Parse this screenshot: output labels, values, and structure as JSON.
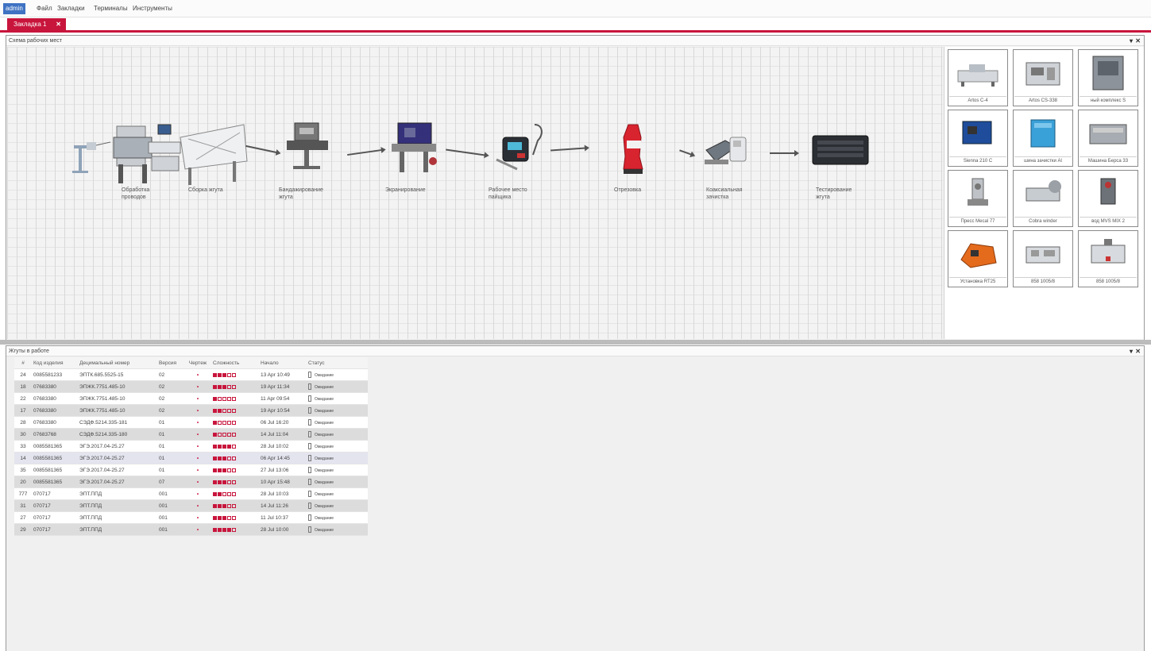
{
  "menubar": {
    "items": [
      "admin",
      "Файл",
      "Закладки",
      "Терминалы",
      "Инструменты"
    ]
  },
  "tab": {
    "label": "Закладка 1",
    "close": "✕"
  },
  "scheme_panel": {
    "title": "Схема рабочих мест",
    "pin": "▾",
    "close": "✕"
  },
  "flow": {
    "stations": [
      {
        "label": "Обработка\nпроводов"
      },
      {
        "label": "Сборка жгута"
      },
      {
        "label": "Бандажирование\nжгута"
      },
      {
        "label": "Экранирование"
      },
      {
        "label": "Рабочее место\nпайщика"
      },
      {
        "label": "Отрезовка"
      },
      {
        "label": "Коаксиальная\nзачистка"
      },
      {
        "label": "Тестирование\nжгута"
      }
    ]
  },
  "equipment": [
    {
      "label": "Artos C-4",
      "icon": "wire-cutting-machine-icon"
    },
    {
      "label": "Artos CS-338",
      "icon": "crimp-machine-icon"
    },
    {
      "label": "ный комплекс S",
      "icon": "cabinet-machine-icon"
    },
    {
      "label": "Sienna 210 C",
      "icon": "blue-machine-icon"
    },
    {
      "label": "шина зачистки Al",
      "icon": "blue-box-icon"
    },
    {
      "label": "Машина Берса 33",
      "icon": "grey-machine-icon"
    },
    {
      "label": "Пресс Mecal 77",
      "icon": "press-icon"
    },
    {
      "label": "Cobra winder",
      "icon": "winder-icon"
    },
    {
      "label": "вод MVS MIX 2",
      "icon": "mixer-icon"
    },
    {
      "label": "Установка RT25",
      "icon": "orange-unit-icon"
    },
    {
      "label": "858 1005/8",
      "icon": "bench-unit-icon"
    },
    {
      "label": "858 1005/8",
      "icon": "bench-unit-icon"
    }
  ],
  "harness_panel": {
    "title": "Жгуты в работе",
    "pin": "▾",
    "close": "✕"
  },
  "table": {
    "headers": {
      "num": "#",
      "code": "Код изделия",
      "decimal": "Децимальный номер",
      "version": "Версия",
      "drawing": "Чертеж",
      "complexity": "Сложность",
      "start": "Начало",
      "status": "Статус"
    },
    "rows": [
      {
        "num": "24",
        "code": "0085581233",
        "decimal": "ЭПТК.685.5525-15",
        "version": "02",
        "drawing": "•",
        "complexity": 3,
        "start": "13 Apr 10:49",
        "status": "Ожидание"
      },
      {
        "num": "18",
        "code": "07683380",
        "decimal": "ЭПЖК.7751.485-10",
        "version": "02",
        "drawing": "•",
        "complexity": 3,
        "start": "19 Apr 11:34",
        "status": "Ожидание"
      },
      {
        "num": "22",
        "code": "07683380",
        "decimal": "ЭПЖК.7751.485-10",
        "version": "02",
        "drawing": "•",
        "complexity": 1,
        "start": "11 Apr 09:54",
        "status": "Ожидание"
      },
      {
        "num": "17",
        "code": "07683380",
        "decimal": "ЭПЖК.7751.485-10",
        "version": "02",
        "drawing": "•",
        "complexity": 2,
        "start": "19 Apr 10:54",
        "status": "Ожидание"
      },
      {
        "num": "28",
        "code": "07683380",
        "decimal": "СЭДФ.5214.335-181",
        "version": "01",
        "drawing": "•",
        "complexity": 1,
        "start": "06 Jul 16:20",
        "status": "Ожидание"
      },
      {
        "num": "30",
        "code": "07683768",
        "decimal": "СЭДФ.5214.335-180",
        "version": "01",
        "drawing": "•",
        "complexity": 1,
        "start": "14 Jul 11:04",
        "status": "Ожидание"
      },
      {
        "num": "33",
        "code": "0085581365",
        "decimal": "ЭГЭ.2017.04-25.27",
        "version": "01",
        "drawing": "•",
        "complexity": 4,
        "start": "28 Jul 10:02",
        "status": "Ожидание"
      },
      {
        "num": "14",
        "code": "0085581365",
        "decimal": "ЭГЭ.2017.04-25.27",
        "version": "01",
        "drawing": "•",
        "complexity": 3,
        "start": "06 Apr 14:45",
        "status": "Ожидание"
      },
      {
        "num": "35",
        "code": "0085581365",
        "decimal": "ЭГЭ.2017.04-25.27",
        "version": "01",
        "drawing": "•",
        "complexity": 3,
        "start": "27 Jul 13:06",
        "status": "Ожидание"
      },
      {
        "num": "20",
        "code": "0085581365",
        "decimal": "ЭГЭ.2017.04-25.27",
        "version": "07",
        "drawing": "•",
        "complexity": 3,
        "start": "10 Apr 15:48",
        "status": "Ожидание"
      },
      {
        "num": "777",
        "code": "070717",
        "decimal": "ЭПТ.ППД",
        "version": "001",
        "drawing": "•",
        "complexity": 2,
        "start": "28 Jul 10:03",
        "status": "Ожидание"
      },
      {
        "num": "31",
        "code": "070717",
        "decimal": "ЭПТ.ППД",
        "version": "001",
        "drawing": "•",
        "complexity": 3,
        "start": "14 Jul 11:26",
        "status": "Ожидание"
      },
      {
        "num": "27",
        "code": "070717",
        "decimal": "ЭПТ.ППД",
        "version": "001",
        "drawing": "•",
        "complexity": 3,
        "start": "11 Jul 10:37",
        "status": "Ожидание"
      },
      {
        "num": "29",
        "code": "070717",
        "decimal": "ЭПТ.ППД",
        "version": "001",
        "drawing": "•",
        "complexity": 4,
        "start": "28 Jul 10:00",
        "status": "Ожидание"
      }
    ],
    "complexity_max": 5,
    "accent_color": "#c8153c"
  }
}
